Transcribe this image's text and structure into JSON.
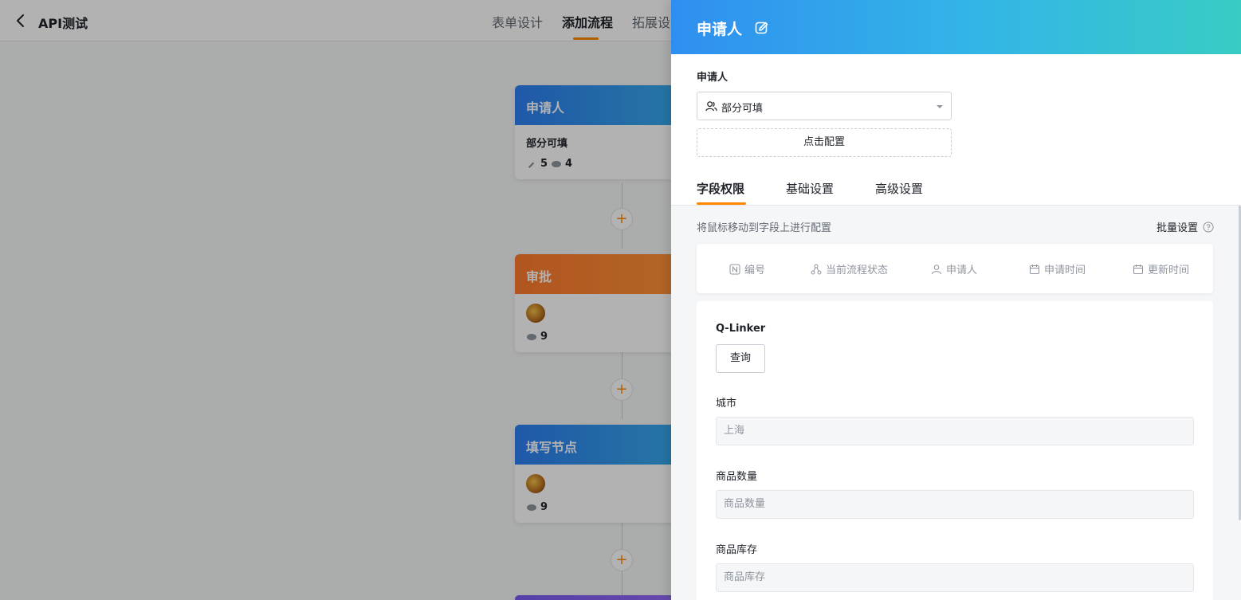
{
  "app": {
    "title": "API测试",
    "tabs": [
      "表单设计",
      "添加流程",
      "拓展设置"
    ],
    "active_tab": "添加流程"
  },
  "flow": {
    "nodes": [
      {
        "title": "申请人",
        "subtitle": "部分可填",
        "edit_count": "5",
        "view_count": "4"
      },
      {
        "title": "审批",
        "view_count": "9"
      },
      {
        "title": "填写节点",
        "view_count": "9"
      }
    ],
    "add_symbol": "+"
  },
  "drawer": {
    "title": "申请人",
    "field_label": "申请人",
    "select_value": "部分可填",
    "config_button": "点击配置",
    "tabs": [
      "字段权限",
      "基础设置",
      "高级设置"
    ],
    "active_tab": "字段权限",
    "hint": "将鼠标移动到字段上进行配置",
    "batch_label": "批量设置",
    "system_fields": [
      {
        "label": "编号",
        "icon": "number-icon"
      },
      {
        "label": "当前流程状态",
        "icon": "flow-status-icon"
      },
      {
        "label": "申请人",
        "icon": "user-icon"
      },
      {
        "label": "申请时间",
        "icon": "calendar-icon"
      },
      {
        "label": "更新时间",
        "icon": "calendar-icon"
      }
    ],
    "form": {
      "qlinker_label": "Q-Linker",
      "query_button": "查询",
      "city_label": "城市",
      "city_value": "上海",
      "qty_label": "商品数量",
      "qty_placeholder": "商品数量",
      "stock_label": "商品库存",
      "stock_placeholder": "商品库存"
    }
  },
  "colors": {
    "accent": "#ff8800",
    "header_gradient_start": "#2f8ff0",
    "header_gradient_end": "#38ccc4",
    "node_blue": "#2d7ff2",
    "node_orange": "#ff7a2e"
  }
}
